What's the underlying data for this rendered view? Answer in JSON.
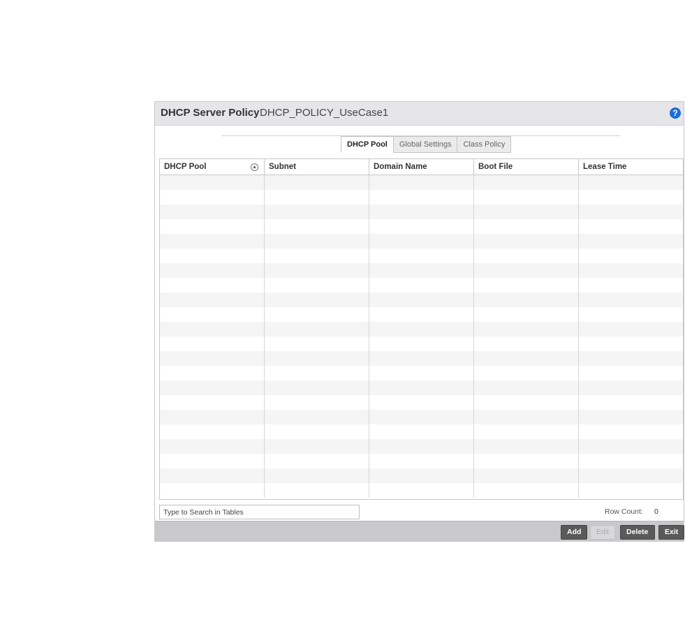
{
  "header": {
    "title": "DHCP Server Policy",
    "policy_name": "DHCP_POLICY_UseCase1",
    "help_glyph": "?"
  },
  "tabs": [
    {
      "label": "DHCP Pool",
      "active": true
    },
    {
      "label": "Global Settings",
      "active": false
    },
    {
      "label": "Class Policy",
      "active": false
    }
  ],
  "table": {
    "columns": [
      "DHCP Pool",
      "Subnet",
      "Domain Name",
      "Boot File",
      "Lease Time"
    ],
    "sorted_column": "DHCP Pool",
    "rows": []
  },
  "search": {
    "placeholder": "Type to Search in Tables"
  },
  "row_count": {
    "label": "Row Count:",
    "value": "0"
  },
  "buttons": {
    "add": "Add",
    "edit": "Edit",
    "delete": "Delete",
    "exit": "Exit"
  },
  "colors": {
    "help_icon": "#1a6ed8",
    "header_bg": "#e6e6e9",
    "footer_bg": "#c9c9cc",
    "button_bg": "#5a5a5a"
  }
}
